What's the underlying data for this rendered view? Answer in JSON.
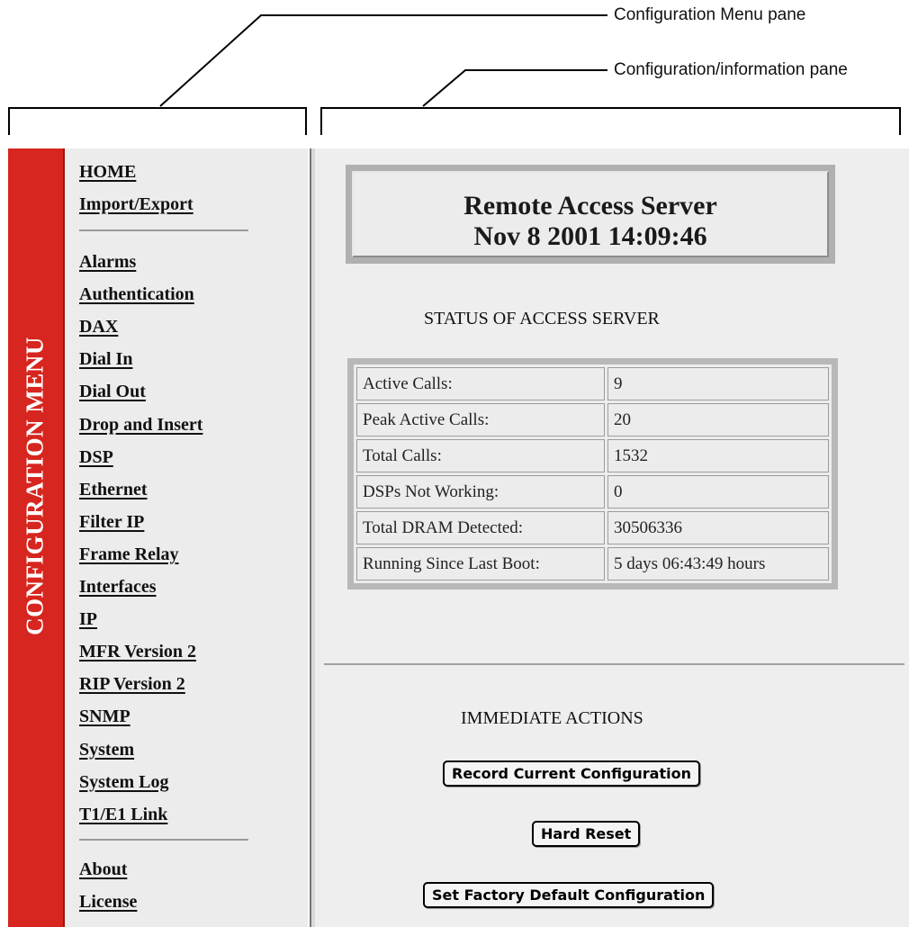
{
  "callouts": {
    "menu_pane": "Configuration Menu pane",
    "info_pane": "Configuration/information pane"
  },
  "banner": {
    "label": "CONFIGURATION MENU",
    "color": "#d6261f"
  },
  "menu": {
    "group1": [
      "HOME",
      "Import/Export"
    ],
    "group2": [
      "Alarms",
      "Authentication",
      "DAX",
      "Dial In",
      "Dial Out",
      "Drop and Insert",
      "DSP",
      "Ethernet",
      "Filter IP",
      "Frame Relay",
      "Interfaces",
      "IP",
      "MFR Version 2",
      "RIP Version 2",
      "SNMP",
      "System",
      "System Log",
      "T1/E1 Link"
    ],
    "group3": [
      "About",
      "License"
    ]
  },
  "header": {
    "title": "Remote Access Server",
    "datetime": "Nov 8 2001 14:09:46"
  },
  "status": {
    "heading": "STATUS OF ACCESS SERVER",
    "rows": [
      {
        "label": "Active Calls:",
        "value": "9"
      },
      {
        "label": "Peak Active Calls:",
        "value": "20"
      },
      {
        "label": "Total Calls:",
        "value": "1532"
      },
      {
        "label": "DSPs Not Working:",
        "value": "0"
      },
      {
        "label": "Total DRAM Detected:",
        "value": "30506336"
      },
      {
        "label": "Running Since Last Boot:",
        "value": "5 days 06:43:49 hours"
      }
    ]
  },
  "actions": {
    "heading": "IMMEDIATE ACTIONS",
    "record_label": "Record Current Configuration",
    "reset_label": "Hard Reset",
    "factory_label": "Set Factory Default Configuration"
  }
}
